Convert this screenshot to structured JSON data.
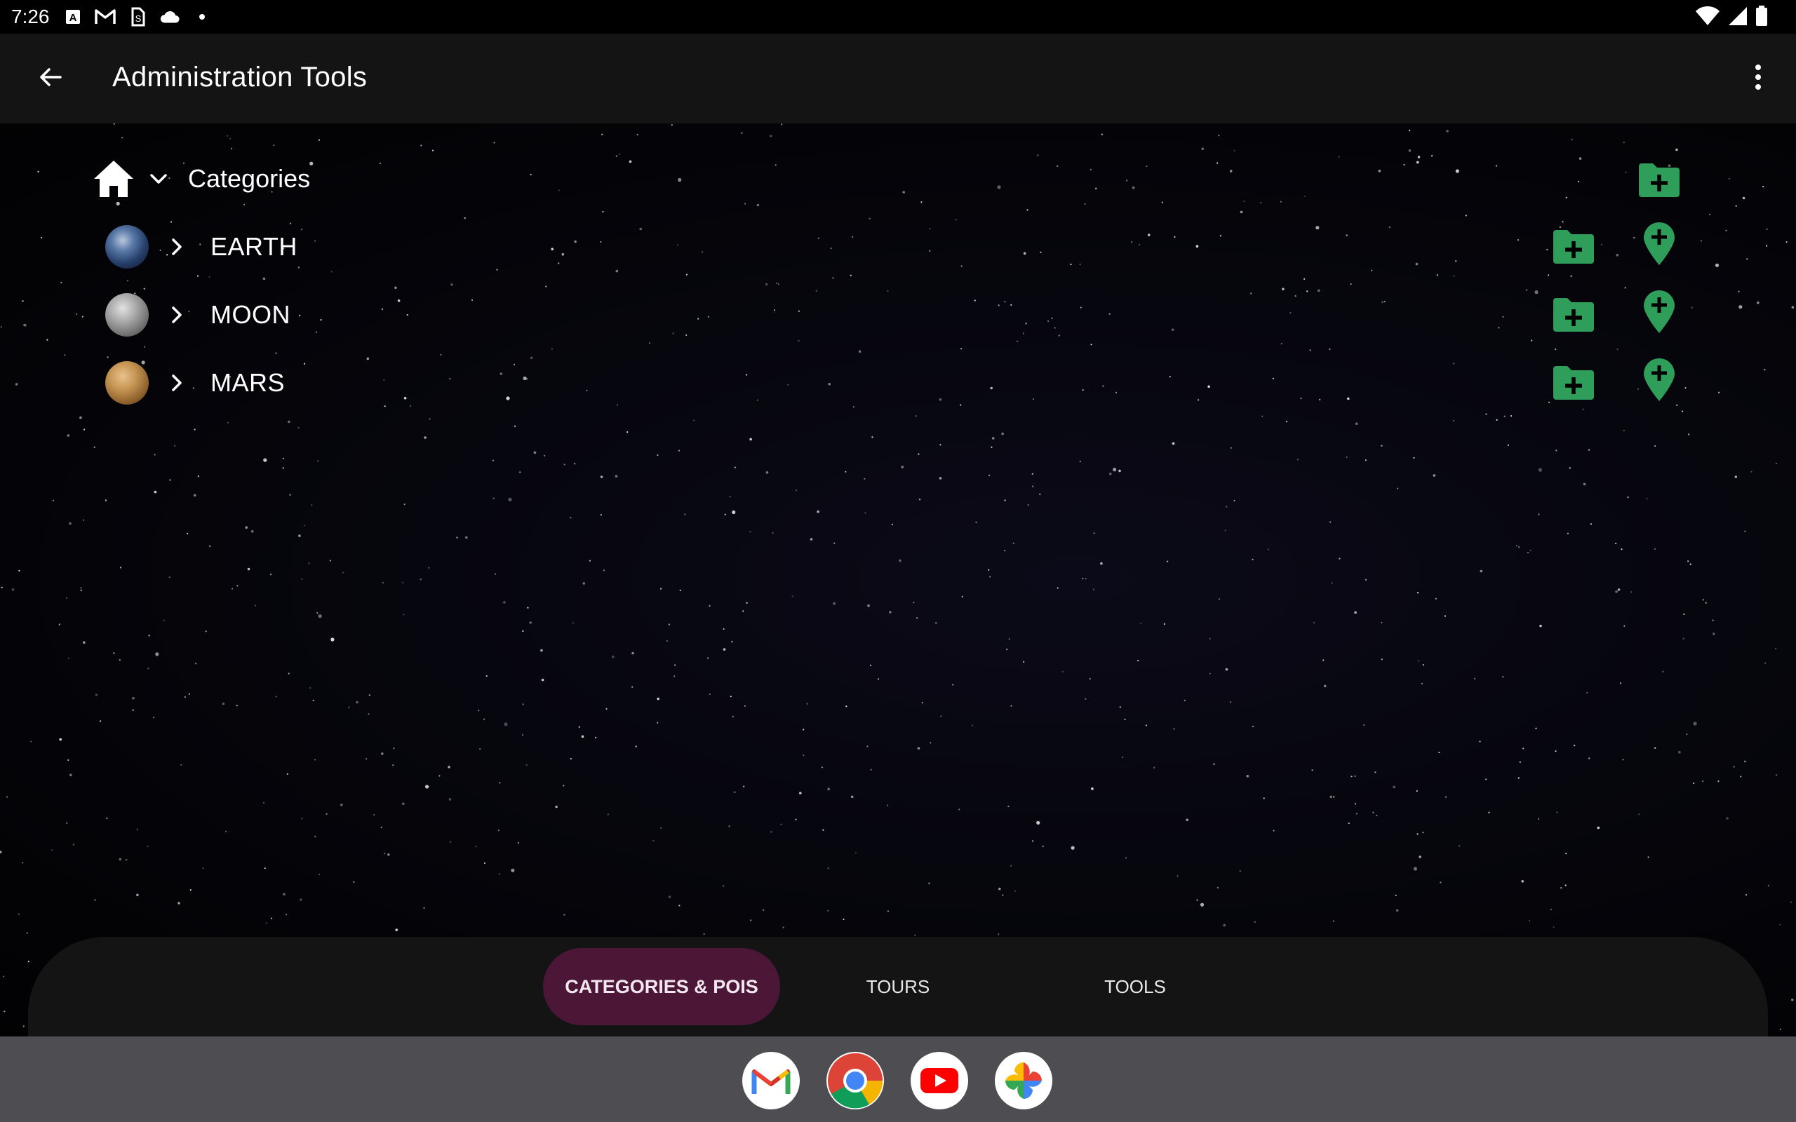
{
  "status_bar": {
    "time": "7:26",
    "left_icons": [
      "a-icon",
      "gmail-icon",
      "sim-icon",
      "cloud-icon",
      "dot-icon"
    ],
    "right_icons": [
      "wifi-icon",
      "signal-icon",
      "battery-icon"
    ]
  },
  "app_bar": {
    "title": "Administration Tools",
    "back_icon": "arrow-back-icon",
    "menu_icon": "more-vert-icon"
  },
  "tree": {
    "root": {
      "label": "Categories",
      "icon": "home-icon",
      "expand_icon": "chevron-down-icon"
    },
    "items": [
      {
        "label": "EARTH",
        "planet": "earth"
      },
      {
        "label": "MOON",
        "planet": "moon"
      },
      {
        "label": "MARS",
        "planet": "mars"
      }
    ],
    "action_color": "#2e9e5a"
  },
  "bottom_nav": {
    "tabs": [
      {
        "label": "CATEGORIES & POIS",
        "active": true
      },
      {
        "label": "TOURS",
        "active": false
      },
      {
        "label": "TOOLS",
        "active": false
      }
    ],
    "active_color": "#4c1636"
  },
  "dock": {
    "apps": [
      "gmail-icon",
      "chrome-icon",
      "youtube-icon",
      "photos-icon"
    ]
  }
}
